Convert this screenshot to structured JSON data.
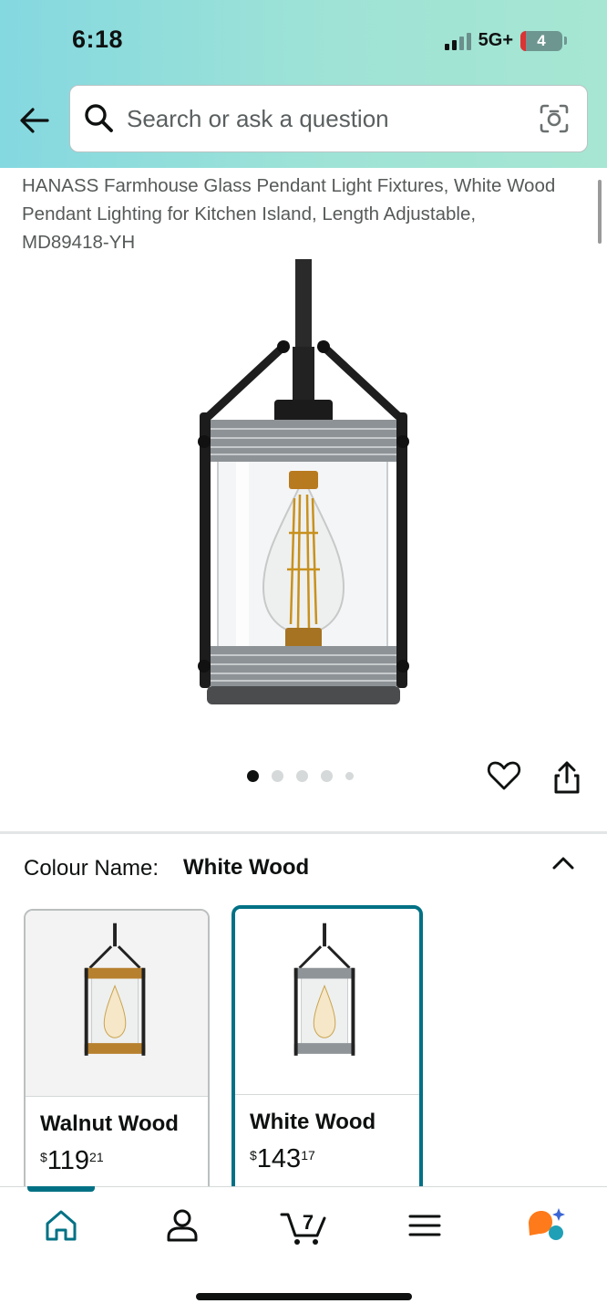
{
  "status_bar": {
    "time": "6:18",
    "network": "5G+",
    "battery": "4"
  },
  "search": {
    "placeholder": "Search or ask a question"
  },
  "product": {
    "title": "HANASS Farmhouse Glass Pendant Light Fixtures, White Wood Pendant Lighting for Kitchen Island, Length Adjustable, MD89418-YH",
    "image_count": 5,
    "active_image_index": 0
  },
  "variation": {
    "label": "Colour Name:",
    "selected": "White Wood",
    "options": [
      {
        "name": "Walnut Wood",
        "currency": "$",
        "price_whole": "119",
        "price_fraction": "21",
        "selected": false
      },
      {
        "name": "White Wood",
        "currency": "$",
        "price_whole": "143",
        "price_fraction": "17",
        "selected": true
      }
    ]
  },
  "tab_bar": {
    "cart_count": "7",
    "active_tab": "home",
    "tabs": [
      "home-icon",
      "account-icon",
      "cart-icon",
      "menu-icon",
      "assistant-icon"
    ]
  },
  "colors": {
    "accent": "#007185",
    "header_gradient_start": "#84d8e0",
    "header_gradient_end": "#a6e6d2"
  }
}
